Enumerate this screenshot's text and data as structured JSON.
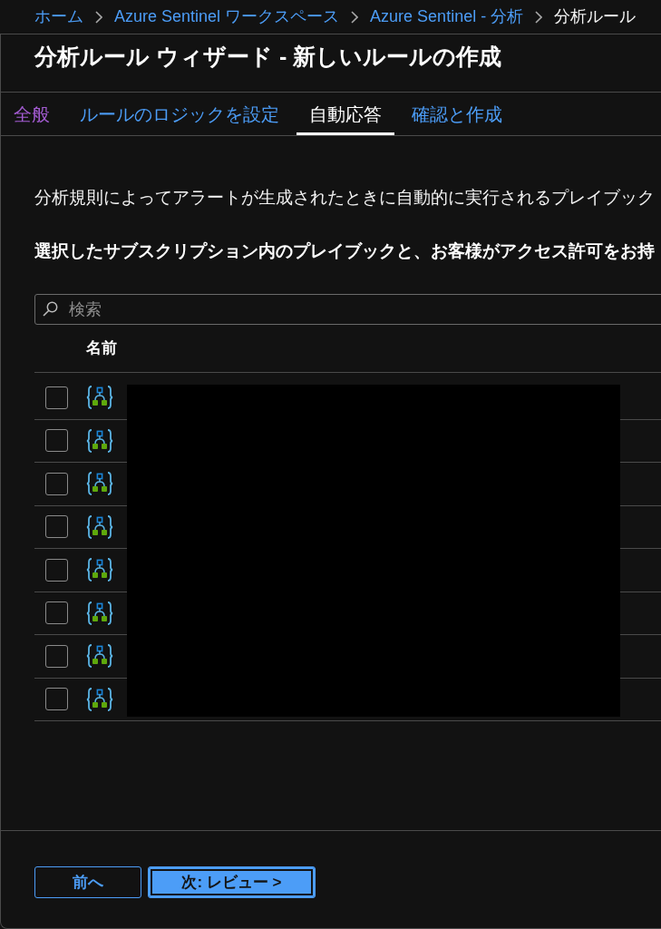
{
  "breadcrumb": [
    {
      "label": "ホーム",
      "current": false
    },
    {
      "label": "Azure Sentinel ワークスペース",
      "current": false
    },
    {
      "label": "Azure Sentinel - 分析",
      "current": false
    },
    {
      "label": "分析ルール",
      "current": true
    }
  ],
  "title": "分析ルール ウィザード - 新しいルールの作成",
  "tabs": [
    {
      "label": "全般",
      "selected": false,
      "visited": true
    },
    {
      "label": "ルールのロジックを設定",
      "selected": false,
      "visited": false
    },
    {
      "label": "自動応答",
      "selected": true,
      "visited": false
    },
    {
      "label": "確認と作成",
      "selected": false,
      "visited": false
    }
  ],
  "description": "分析規則によってアラートが生成されたときに自動的に実行されるプレイブック",
  "note": "選択したサブスクリプション内のプレイブックと、お客様がアクセス許可をお持",
  "search": {
    "placeholder": "検索"
  },
  "table": {
    "columns": [
      "名前"
    ],
    "names_redacted": true,
    "rows": [
      {
        "checked": false
      },
      {
        "checked": false
      },
      {
        "checked": false
      },
      {
        "checked": false
      },
      {
        "checked": false
      },
      {
        "checked": false
      },
      {
        "checked": false
      },
      {
        "checked": false
      }
    ]
  },
  "buttons": [
    {
      "label": "前へ",
      "kind": "secondary",
      "focused": false
    },
    {
      "label": "次: レビュー >",
      "kind": "primary",
      "focused": true
    }
  ]
}
